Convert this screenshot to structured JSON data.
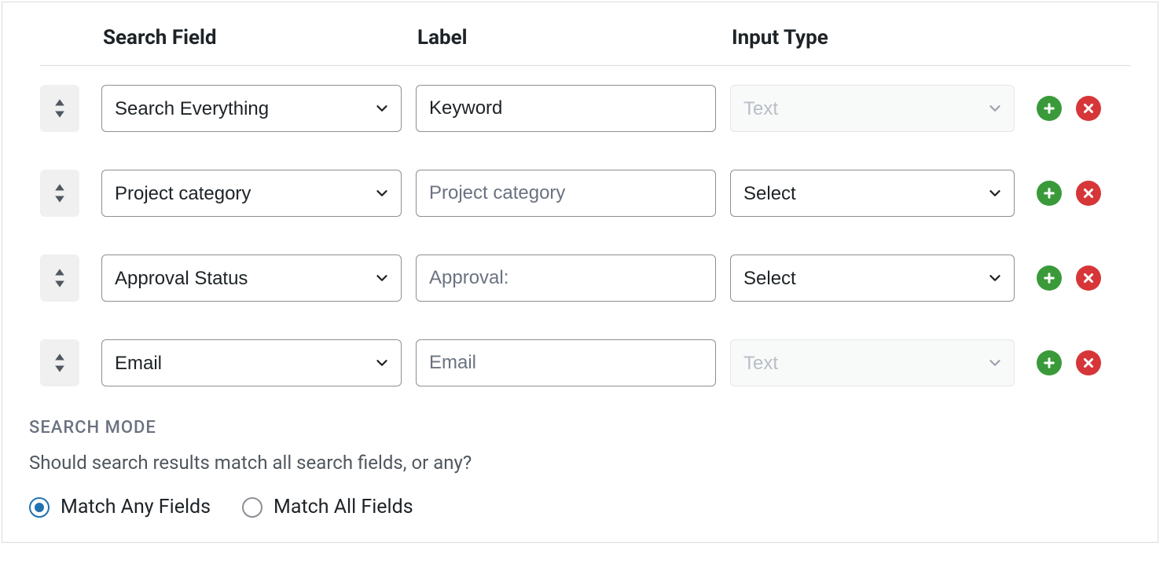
{
  "headers": {
    "search_field": "Search Field",
    "label": "Label",
    "input_type": "Input Type"
  },
  "rows": [
    {
      "search_field": "Search Everything",
      "label_value": "Keyword",
      "label_placeholder": "",
      "input_type": "Text",
      "input_type_disabled": true
    },
    {
      "search_field": "Project category",
      "label_value": "",
      "label_placeholder": "Project category",
      "input_type": "Select",
      "input_type_disabled": false
    },
    {
      "search_field": "Approval Status",
      "label_value": "",
      "label_placeholder": "Approval:",
      "input_type": "Select",
      "input_type_disabled": false
    },
    {
      "search_field": "Email",
      "label_value": "",
      "label_placeholder": "Email",
      "input_type": "Text",
      "input_type_disabled": true
    }
  ],
  "search_mode": {
    "title": "SEARCH MODE",
    "desc": "Should search results match all search fields, or any?",
    "options": {
      "any": "Match Any Fields",
      "all": "Match All Fields"
    },
    "selected": "any"
  }
}
